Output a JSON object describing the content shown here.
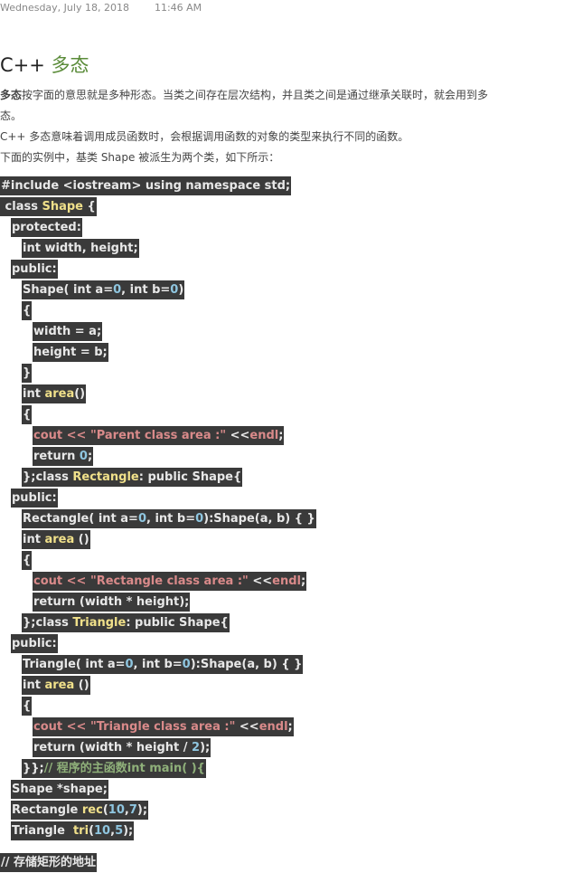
{
  "header": {
    "date": "Wednesday, July 18, 2018",
    "time": "11:46 AM"
  },
  "title": {
    "prefix": "C++ ",
    "main": "多态"
  },
  "paragraphs": {
    "p1_bold": "多态",
    "p1_rest": "按字面的意思就是多种形态。当类之间存在层次结构，并且类之间是通过继承关联时，就会用到多",
    "p1_cont": "态。",
    "p2": "C++ 多态意味着调用成员函数时，会根据调用函数的对象的类型来执行不同的函数。",
    "p3": "下面的实例中，基类 Shape 被派生为两个类，如下所示："
  },
  "code": {
    "l01": "#include <iostream> using namespace std;",
    "l02a": " class ",
    "l02b": "Shape",
    "l02c": " {",
    "l03": "protected:",
    "l04": "int width, height;",
    "l05": "public:",
    "l06a": "Shape( int a=",
    "l06b": "0",
    "l06c": ", int b=",
    "l06d": "0",
    "l06e": ")",
    "l07": "{",
    "l08": "width = a;",
    "l09": "height = b;",
    "l10": "}",
    "l11a": "int ",
    "l11b": "area",
    "l11c": "()",
    "l12": "{",
    "l13a": "cout << ",
    "l13b": "\"Parent class area :\"",
    "l13c": " <<",
    "l13d": "endl",
    "l13e": ";",
    "l14a": "return ",
    "l14b": "0",
    "l14c": ";",
    "l15a": "};class ",
    "l15b": "Rectangle",
    "l15c": ": public Shape{",
    "l16": "public:",
    "l17a": "Rectangle( int a=",
    "l17b": "0",
    "l17c": ", int b=",
    "l17d": "0",
    "l17e": "):Shape(a, b) { }",
    "l18a": "int ",
    "l18b": "area",
    "l18c": " ()",
    "l19": "{",
    "l20a": "cout << ",
    "l20b": "\"Rectangle class area :\"",
    "l20c": " <<",
    "l20d": "endl",
    "l20e": ";",
    "l21": "return (width * height);",
    "l22a": "};class ",
    "l22b": "Triangle",
    "l22c": ": public Shape{",
    "l23": "public:",
    "l24a": "Triangle( int a=",
    "l24b": "0",
    "l24c": ", int b=",
    "l24d": "0",
    "l24e": "):Shape(a, b) { }",
    "l25a": "int ",
    "l25b": "area",
    "l25c": " ()",
    "l26": "{",
    "l27a": "cout << ",
    "l27b": "\"Triangle class area :\"",
    "l27c": " <<",
    "l27d": "endl",
    "l27e": ";",
    "l28a": "return (width * height / ",
    "l28b": "2",
    "l28c": ");",
    "l29a": "}};",
    "l29b": "// 程序的主函数int main( ){",
    "l30": "Shape *shape;",
    "l31a": "Rectangle ",
    "l31b": "rec",
    "l31c": "(",
    "l31d": "10",
    "l31e": ",",
    "l31f": "7",
    "l31g": ");",
    "l32a": "Triangle  ",
    "l32b": "tri",
    "l32c": "(",
    "l32d": "10",
    "l32e": ",",
    "l32f": "5",
    "l32g": ");",
    "l33": "// 存储矩形的地址"
  },
  "colors": {
    "code_bg": "#3a3a3a",
    "title_accent": "#5b8c3a",
    "string": "#d98a8a",
    "number": "#8fc6e0",
    "keyword": "#f0e08a",
    "comment": "#8fb07a"
  }
}
